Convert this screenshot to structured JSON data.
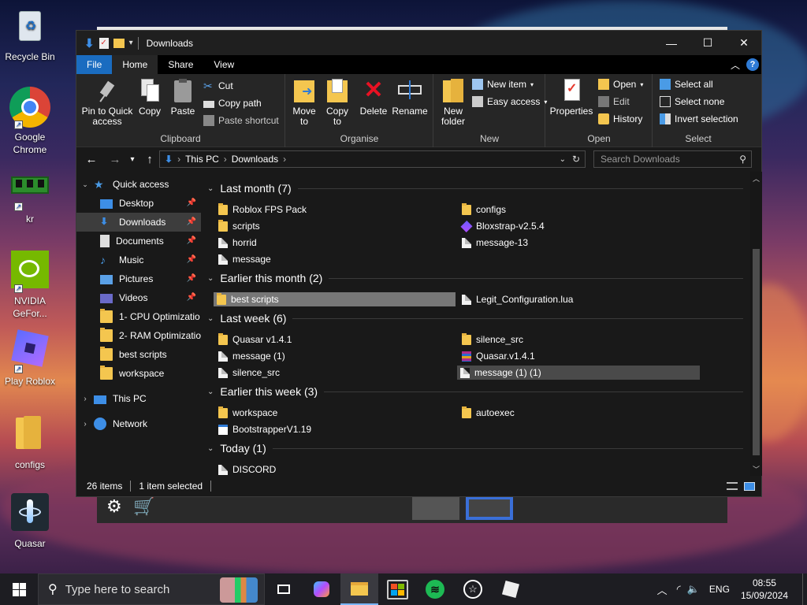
{
  "desktop": {
    "icons": [
      {
        "label": "Recycle Bin"
      },
      {
        "label": "Google Chrome"
      },
      {
        "label": "kr"
      },
      {
        "label": "NVIDIA GeFor..."
      },
      {
        "label": "Play Roblox"
      },
      {
        "label": "configs"
      },
      {
        "label": "Quasar"
      }
    ]
  },
  "window": {
    "title": "Downloads",
    "buttons": {
      "minimize": "—",
      "maximize": "☐",
      "close": "✕"
    }
  },
  "ribbon_tabs": [
    "File",
    "Home",
    "Share",
    "View"
  ],
  "ribbon": {
    "clipboard": {
      "label": "Clipboard",
      "pin": "Pin to Quick access",
      "copy": "Copy",
      "paste": "Paste",
      "cut": "Cut",
      "copy_path": "Copy path",
      "paste_shortcut": "Paste shortcut"
    },
    "organise": {
      "label": "Organise",
      "move_to": "Move to",
      "copy_to": "Copy to",
      "delete": "Delete",
      "rename": "Rename"
    },
    "new": {
      "label": "New",
      "new_folder": "New folder",
      "new_item": "New item",
      "easy_access": "Easy access"
    },
    "open": {
      "label": "Open",
      "properties": "Properties",
      "open": "Open",
      "edit": "Edit",
      "history": "History"
    },
    "select": {
      "label": "Select",
      "select_all": "Select all",
      "select_none": "Select none",
      "invert": "Invert selection"
    }
  },
  "address": {
    "crumbs": [
      "This PC",
      "Downloads"
    ],
    "search_placeholder": "Search Downloads"
  },
  "nav": {
    "quick_access": "Quick access",
    "items": [
      "Desktop",
      "Downloads",
      "Documents",
      "Music",
      "Pictures",
      "Videos",
      "1- CPU Optimizatio",
      "2- RAM Optimizatio",
      "best scripts",
      "workspace"
    ],
    "this_pc": "This PC",
    "network": "Network"
  },
  "groups": [
    {
      "header": "Last month (7)",
      "files": [
        {
          "name": "Roblox FPS Pack",
          "type": "folder"
        },
        {
          "name": "configs",
          "type": "folder"
        },
        {
          "name": "scripts",
          "type": "folder"
        },
        {
          "name": "Bloxstrap-v2.5.4",
          "type": "app"
        },
        {
          "name": "horrid",
          "type": "doc"
        },
        {
          "name": "message-13",
          "type": "doc"
        },
        {
          "name": "message",
          "type": "doc"
        }
      ]
    },
    {
      "header": "Earlier this month (2)",
      "files": [
        {
          "name": "best scripts",
          "type": "folder",
          "selected": true
        },
        {
          "name": "Legit_Configuration.lua",
          "type": "doc"
        }
      ]
    },
    {
      "header": "Last week (6)",
      "files": [
        {
          "name": "Quasar v1.4.1",
          "type": "folder"
        },
        {
          "name": "silence_src",
          "type": "folder"
        },
        {
          "name": "message (1)",
          "type": "doc"
        },
        {
          "name": "Quasar.v1.4.1",
          "type": "rar"
        },
        {
          "name": "silence_src",
          "type": "doc"
        },
        {
          "name": "message (1) (1)",
          "type": "doc",
          "hover": true
        }
      ]
    },
    {
      "header": "Earlier this week (3)",
      "files": [
        {
          "name": "workspace",
          "type": "folder"
        },
        {
          "name": "autoexec",
          "type": "folder"
        },
        {
          "name": "BootstrapperV1.19",
          "type": "app"
        }
      ]
    },
    {
      "header": "Today (1)",
      "files": [
        {
          "name": "DISCORD",
          "type": "doc"
        }
      ]
    }
  ],
  "status": {
    "count": "26 items",
    "selected": "1 item selected"
  },
  "taskbar": {
    "search_placeholder": "Type here to search",
    "lang": "ENG",
    "time": "08:55",
    "date": "15/09/2024"
  },
  "colors": {
    "accent": "#1a6cc0",
    "folder": "#f4c64f",
    "window_bg": "#191919",
    "ribbon_bg": "#262626"
  }
}
